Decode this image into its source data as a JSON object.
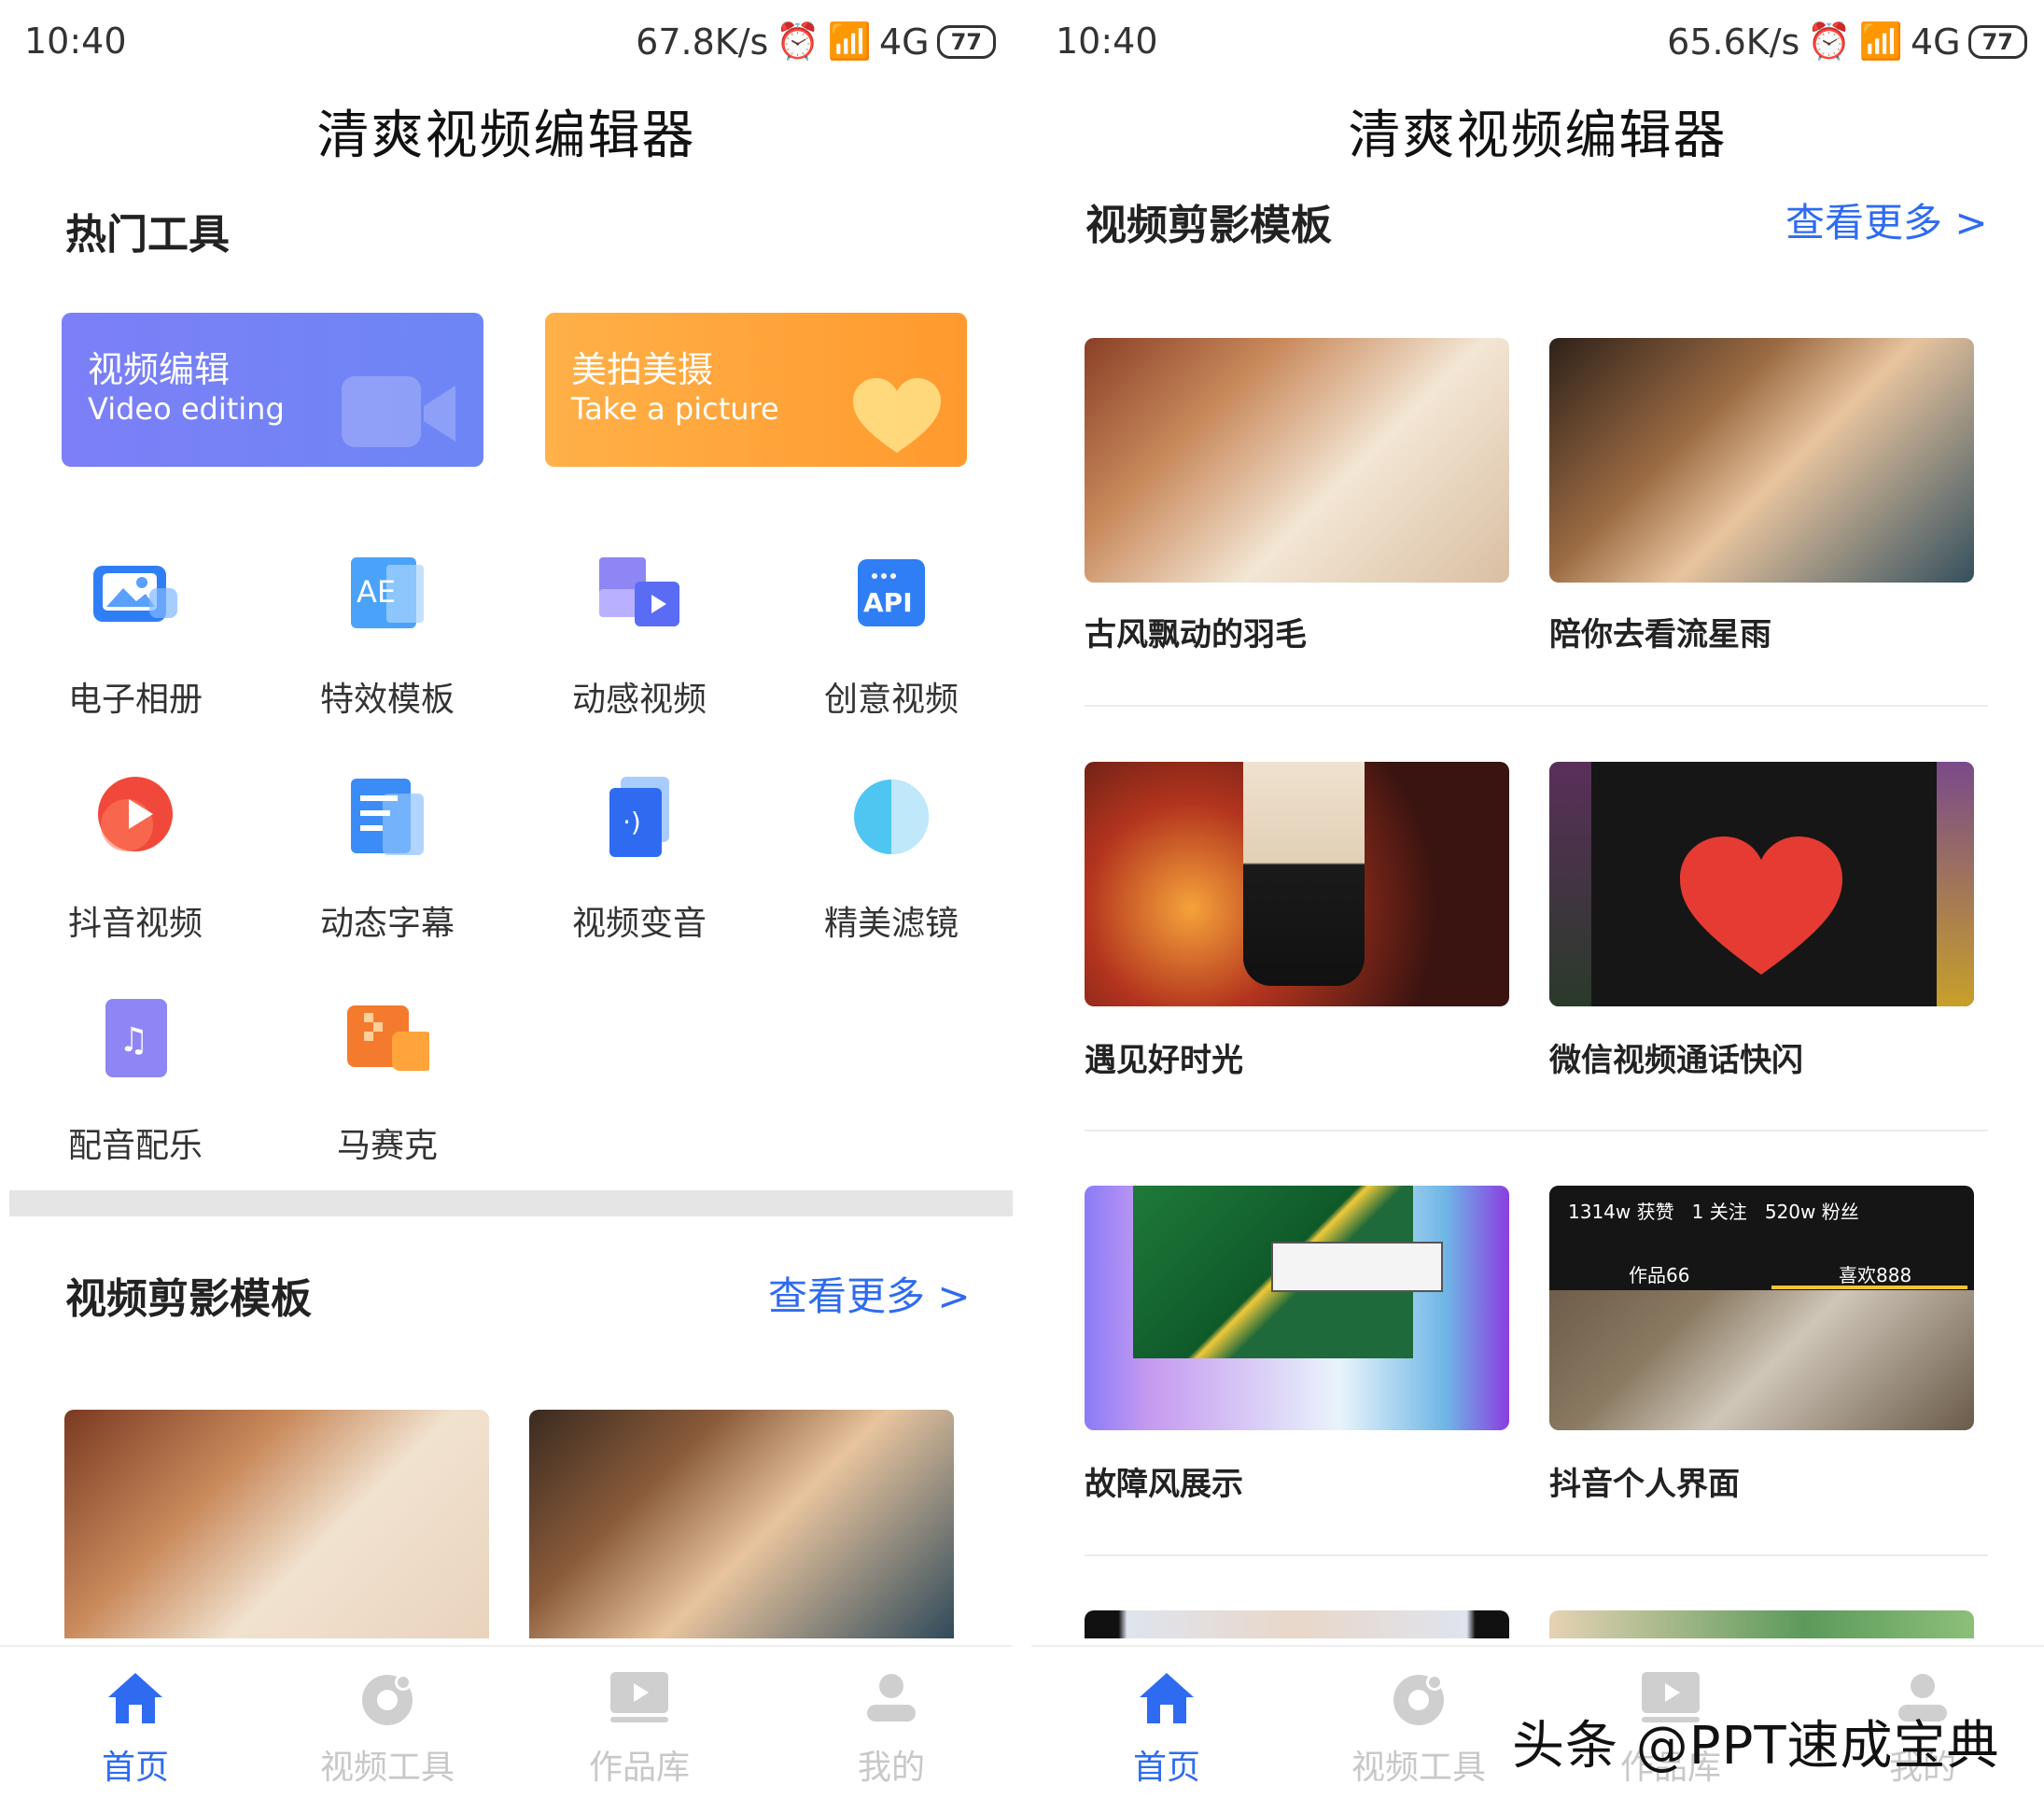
{
  "left": {
    "status": {
      "time": "10:40",
      "speed": "67.8K/s",
      "network": "4G",
      "battery": "77"
    },
    "app_title": "清爽视频编辑器",
    "hot_tools_title": "热门工具",
    "big_cards": [
      {
        "title": "视频编辑",
        "subtitle": "Video editing"
      },
      {
        "title": "美拍美摄",
        "subtitle": "Take a picture"
      }
    ],
    "tools": [
      {
        "label": "电子相册",
        "icon": "photo-album-icon"
      },
      {
        "label": "特效模板",
        "icon": "ae-template-icon"
      },
      {
        "label": "动感视频",
        "icon": "dynamic-video-icon"
      },
      {
        "label": "创意视频",
        "icon": "api-icon"
      },
      {
        "label": "抖音视频",
        "icon": "play-circle-icon"
      },
      {
        "label": "动态字幕",
        "icon": "subtitle-doc-icon"
      },
      {
        "label": "视频变音",
        "icon": "voice-change-icon"
      },
      {
        "label": "精美滤镜",
        "icon": "filter-circle-icon"
      },
      {
        "label": "配音配乐",
        "icon": "music-note-icon"
      },
      {
        "label": "马赛克",
        "icon": "mosaic-icon"
      }
    ],
    "template_section": {
      "title": "视频剪影模板",
      "more": "查看更多 >"
    }
  },
  "right": {
    "status": {
      "time": "10:40",
      "speed": "65.6K/s",
      "network": "4G",
      "battery": "77"
    },
    "app_title": "清爽视频编辑器",
    "template_section": {
      "title": "视频剪影模板",
      "more": "查看更多 >"
    },
    "templates": [
      {
        "caption": "古风飘动的羽毛"
      },
      {
        "caption": "陪你去看流星雨"
      },
      {
        "caption": "遇见好时光"
      },
      {
        "caption": "微信视频通话快闪"
      },
      {
        "caption": "故障风展示"
      },
      {
        "caption": "抖音个人界面"
      }
    ],
    "douyin_thumb": {
      "stats": "1314w 获赞   1 关注   520w 粉丝",
      "tab1": "作品66",
      "tab2": "喜欢888"
    }
  },
  "tabbar": [
    {
      "label": "首页",
      "icon": "home-icon",
      "active": true
    },
    {
      "label": "视频工具",
      "icon": "video-tool-icon",
      "active": false
    },
    {
      "label": "作品库",
      "icon": "works-library-icon",
      "active": false
    },
    {
      "label": "我的",
      "icon": "profile-icon",
      "active": false
    }
  ],
  "watermark": "头条 @PPT速成宝典",
  "colors": {
    "accent": "#2f6bf0",
    "orange": "#ffa53a",
    "blue_card": "#7a80f6"
  }
}
